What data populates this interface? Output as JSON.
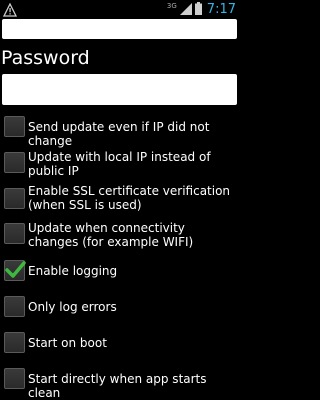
{
  "status_bar": {
    "app_icon": "warning-triangle-icon",
    "network_type": "3G",
    "signal_icon": "signal-strength-icon",
    "battery_icon": "battery-icon",
    "time": "7:17",
    "accent_color": "#33b5e5"
  },
  "form": {
    "top_field_value": "",
    "password_label": "Password",
    "password_value": ""
  },
  "options": [
    {
      "label": "Send update even if IP did not change",
      "checked": false
    },
    {
      "label": "Update with local IP instead of public IP",
      "checked": false
    },
    {
      "label": "Enable SSL certificate verification (when SSL is used)",
      "checked": false
    },
    {
      "label": "Update when connectivity changes (for example WIFI)",
      "checked": false
    },
    {
      "label": "Enable logging",
      "checked": true
    },
    {
      "label": "Only log errors",
      "checked": false
    },
    {
      "label": "Start on boot",
      "checked": false
    },
    {
      "label": "Start directly when app starts clean",
      "checked": false
    }
  ],
  "check_color": "#3fb83f"
}
